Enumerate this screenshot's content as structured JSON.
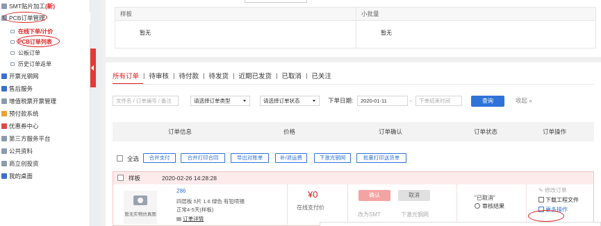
{
  "sidebar": {
    "items": [
      {
        "label": "SMT贴片加工",
        "badge": "(新)"
      },
      {
        "label": "PCB订单管理"
      },
      {
        "label": "开票光钢网"
      },
      {
        "label": "售后服务"
      },
      {
        "label": "增值税票开票管理"
      },
      {
        "label": "预付款系统"
      },
      {
        "label": "优惠券中心"
      },
      {
        "label": "第三方服务平台"
      },
      {
        "label": "公共资料"
      },
      {
        "label": "商立创投资"
      },
      {
        "label": "我的桌面"
      }
    ],
    "sub_items": [
      {
        "label": "在线下单/计价"
      },
      {
        "label": "PCB订单列表"
      },
      {
        "label": "公板订单"
      },
      {
        "label": "历史订单返单"
      }
    ]
  },
  "top_card": {
    "columns": [
      {
        "header": "样板",
        "value": "暂无"
      },
      {
        "header": "小批量",
        "value": "暂无"
      }
    ]
  },
  "tabs": [
    "所有订单",
    "待审核",
    "待付款",
    "待发货",
    "近期已发货",
    "已取消",
    "已关注"
  ],
  "filters": {
    "keyword_placeholder": "文件名 / 订单编号 / 备注",
    "order_type": "请选择订单类型",
    "order_status": "请选择订单状态",
    "date_label": "下单日期:",
    "date_start": "2020-01-11",
    "date_end_placeholder": "下单结束时间",
    "search_label": "查询",
    "collapse_label": "收起",
    "collapse_icon": "double-chevron-left-icon"
  },
  "table_headers": [
    "订单信息",
    "价格",
    "订单确认",
    "订单状态",
    "订单操作"
  ],
  "bulk": {
    "select_all": "全选",
    "buttons": [
      "合并支付",
      "合并打印合同",
      "导出对账单",
      "补/退运费",
      "下激光钢网",
      "批量打印送货单"
    ]
  },
  "order": {
    "type": "样板",
    "datetime": "2020-02-26 14:28:28",
    "thumb_label": "暂无实物仿真图",
    "number": "286",
    "specs": "四层板   5片   1.6   绿色   有铅喷锡",
    "leadtime": "正常4-5天(样板)",
    "detail_link": "订单详情",
    "price": "¥0",
    "price_sub": "在线支付价",
    "pay_label": "确认",
    "cancel_label": "取消",
    "link_smt": "改为SMT",
    "link_stencil": "下激光钢网",
    "status": "\"已取消\"",
    "audit": "审核结果",
    "ops": [
      "修改订单",
      "下载工程文件",
      "更多操作"
    ]
  },
  "colors": {
    "accent_red": "#e02020",
    "primary_blue": "#2f73d9",
    "order_header_bg": "#fdeaea"
  }
}
